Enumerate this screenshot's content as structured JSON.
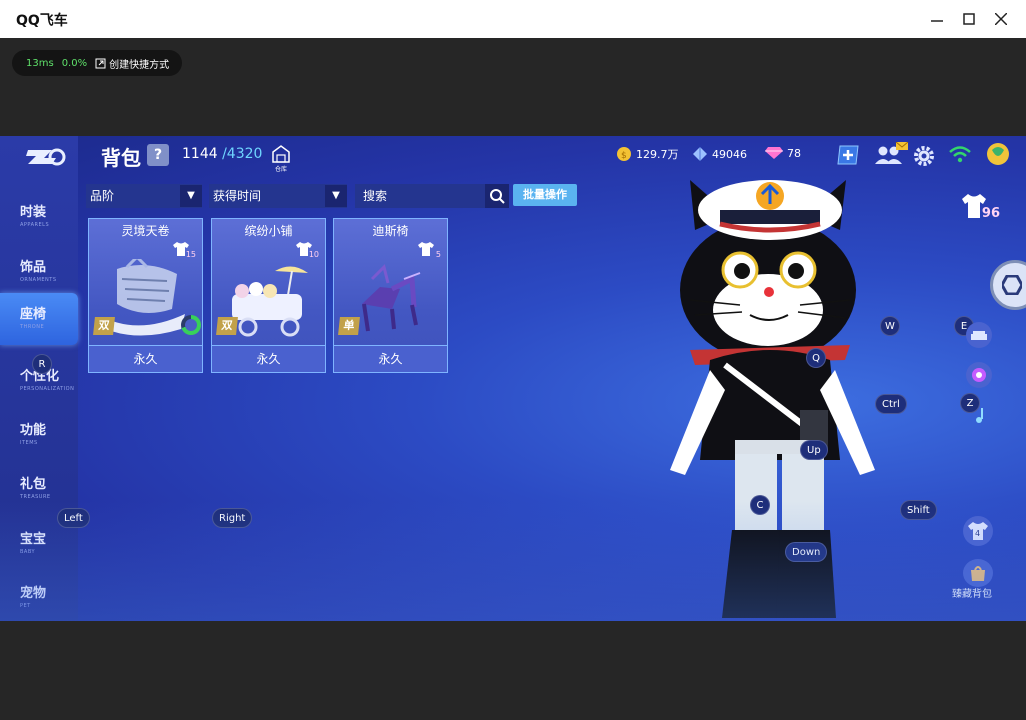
{
  "window": {
    "title": "QQ飞车"
  },
  "overlay": {
    "latency": "13ms",
    "loss": "0.0%",
    "shortcut_label": "创建快捷方式"
  },
  "header": {
    "title": "背包",
    "help": "?",
    "count_current": "1144",
    "count_max": "/4320",
    "warehouse_label": "仓库"
  },
  "filters": {
    "rarity": "品阶",
    "sort": "获得时间",
    "search_placeholder": "搜索",
    "batch_button": "批量操作"
  },
  "sidebar": {
    "items": [
      {
        "zh": "时装",
        "en": "APPARELS"
      },
      {
        "zh": "饰品",
        "en": "ORNAMENTS"
      },
      {
        "zh": "座椅",
        "en": "THRONE"
      },
      {
        "zh": "个性化",
        "en": "PERSONALIZATION"
      },
      {
        "zh": "功能",
        "en": "ITEMS"
      },
      {
        "zh": "礼包",
        "en": "TREASURE"
      },
      {
        "zh": "宝宝",
        "en": "BABY"
      },
      {
        "zh": "宠物",
        "en": "PET"
      }
    ]
  },
  "items": [
    {
      "name": "灵境天卷",
      "stars": "15",
      "tag": "双",
      "duration": "永久",
      "progress": 0.7
    },
    {
      "name": "缤纷小铺",
      "stars": "10",
      "tag": "双",
      "duration": "永久"
    },
    {
      "name": "迪斯椅",
      "stars": "5",
      "tag": "单",
      "duration": "永久"
    }
  ],
  "currency": {
    "coins": "129.7万",
    "crystals": "49046",
    "diamonds": "78"
  },
  "wardrobe_count": "96",
  "right_panel": {
    "bag_label": "臻藏背包",
    "outfit_count": "4"
  },
  "keys": {
    "R": "R",
    "Left": "Left",
    "Right": "Right",
    "W": "W",
    "E": "E",
    "Q": "Q",
    "Ctrl": "Ctrl",
    "Z": "Z",
    "Up": "Up",
    "C": "C",
    "Shift": "Shift",
    "Down": "Down"
  },
  "colors": {
    "accent": "#5ab3f0",
    "active_tab": "#2e64df",
    "wifi": "#33d66b"
  }
}
